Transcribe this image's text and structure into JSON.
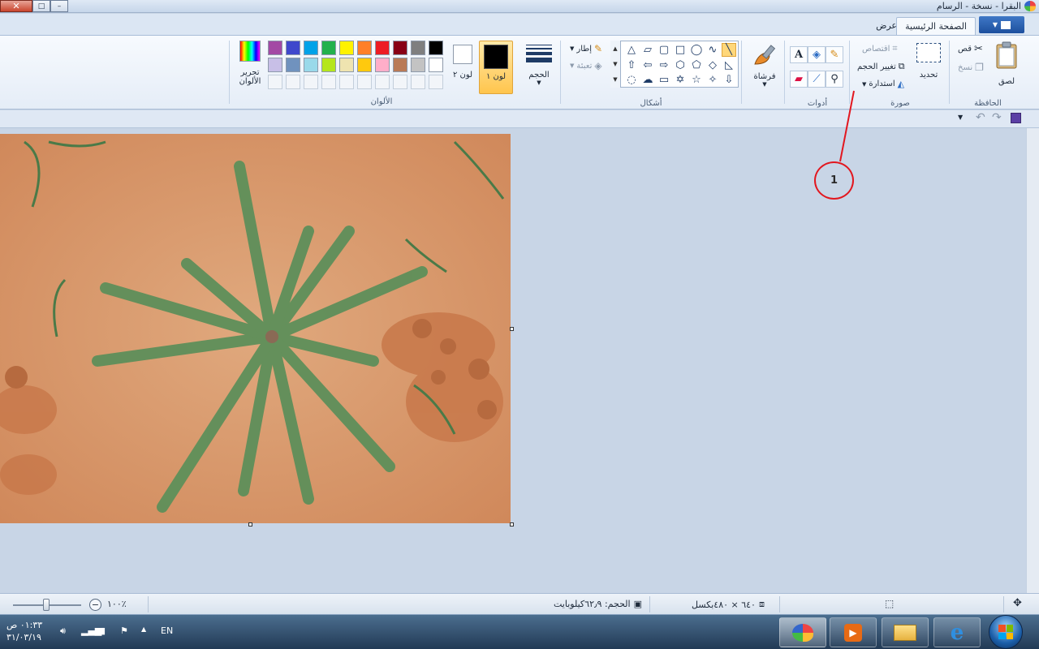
{
  "window": {
    "title": "البقرا - نسخة - الرسام",
    "minimize_glyph": "–",
    "maximize_glyph": "□",
    "close_glyph": "✕"
  },
  "tabs": {
    "home": "الصفحة الرئيسية",
    "view": "عرض"
  },
  "clipboard": {
    "label": "الحافظة",
    "paste": "لصق",
    "cut": "قص",
    "copy": "نسخ"
  },
  "image": {
    "label": "صورة",
    "select": "تحديد",
    "crop": "اقتصاص",
    "resize": "تغيير الحجم",
    "rotate": "استدارة"
  },
  "tools": {
    "label": "أدوات"
  },
  "brushes": {
    "label": "فرشاة"
  },
  "shapes": {
    "label": "أشكال",
    "outline": "إطار",
    "fill": "تعبئة"
  },
  "size": {
    "label": "الحجم"
  },
  "colors": {
    "label": "الألوان",
    "color1": "لون ١",
    "color2": "لون ٢",
    "edit_colors": "تحرير الألوان",
    "color1_value": "#000000",
    "color2_value": "#ffffff",
    "palette_row1": [
      "#000000",
      "#7f7f7f",
      "#880015",
      "#ed1c24",
      "#ff7f27",
      "#fff200",
      "#22b14c",
      "#00a2e8",
      "#3f48cc",
      "#a349a4"
    ],
    "palette_row2": [
      "#ffffff",
      "#c3c3c3",
      "#b97a57",
      "#ffaec9",
      "#ffc90e",
      "#efe4b0",
      "#b5e61d",
      "#99d9ea",
      "#7092be",
      "#c8bfe7"
    ]
  },
  "annotation": {
    "number": "1",
    "color": "#e2171f"
  },
  "status": {
    "zoom": "١٠٠٪",
    "file_size": "الحجم: ٦٢٫٩كيلوبايت",
    "dimensions": "٦٤٠ × ٤٨٠بكسل"
  },
  "taskbar": {
    "time": "٠١:٣٣ ص",
    "date": "٣١/٠٣/١٩",
    "language": "EN"
  }
}
